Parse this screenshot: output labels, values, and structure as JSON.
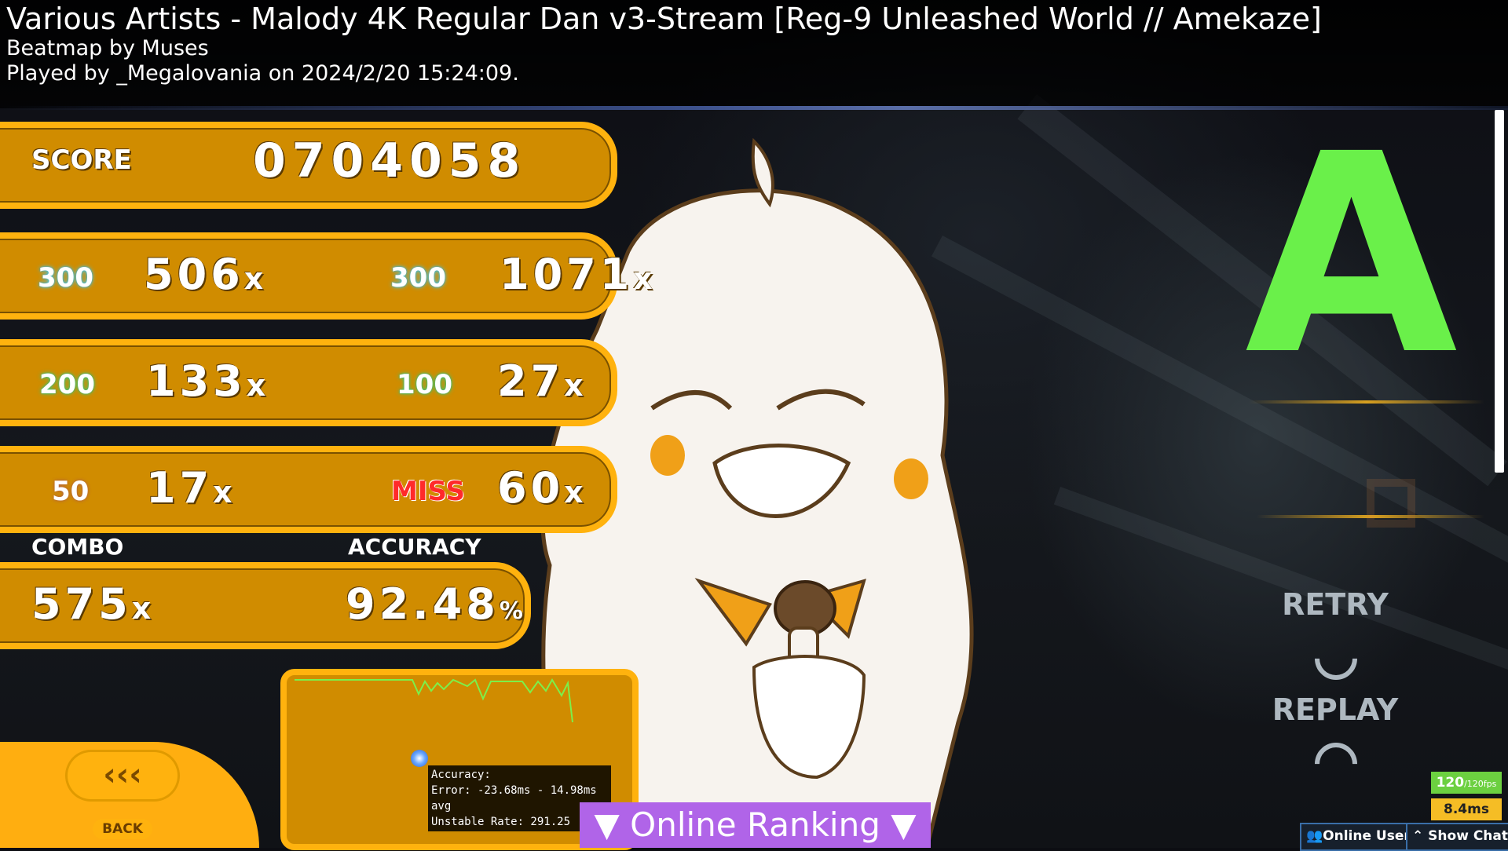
{
  "header": {
    "title": "Various Artists - Malody 4K Regular Dan v3-Stream [Reg-9 Unleashed World // Amekaze]",
    "beatmap_by": "Beatmap by Muses",
    "played_by": "Played by _Megalovania on 2024/2/20 15:24:09."
  },
  "score": {
    "label": "SCORE",
    "value": "0704058"
  },
  "judgements": {
    "j300": {
      "label": "300",
      "count": "506"
    },
    "j300g": {
      "label": "300",
      "count": "1071"
    },
    "j200": {
      "label": "200",
      "count": "133"
    },
    "j100": {
      "label": "100",
      "count": "27"
    },
    "j50": {
      "label": "50",
      "count": "17"
    },
    "miss": {
      "label": "MISS",
      "count": "60"
    },
    "x_suffix": "x"
  },
  "combo": {
    "label": "COMBO",
    "value": "575",
    "suffix": "x"
  },
  "accuracy": {
    "label": "ACCURACY",
    "value": "92.48",
    "suffix": "%"
  },
  "rank": {
    "letter": "A",
    "color": "#6af04a"
  },
  "buttons": {
    "retry": "RETRY",
    "replay": "REPLAY",
    "back_arrows": "‹‹‹",
    "back": "BACK"
  },
  "graph_tooltip": {
    "line1": "Accuracy:",
    "line2": "Error: -23.68ms - 14.98ms avg",
    "line3": "Unstable Rate: 291.25"
  },
  "online_ranking": {
    "label": "Online Ranking"
  },
  "status": {
    "fps": "120",
    "fps_max": "/120fps",
    "frametime": "8.4ms"
  },
  "bottom_buttons": {
    "online_users": "Online Users",
    "show_chat": "Show Chat"
  },
  "colors": {
    "panel": "#d08c00",
    "panel_border": "#ffb20e",
    "accent_purple": "#b064e8"
  }
}
